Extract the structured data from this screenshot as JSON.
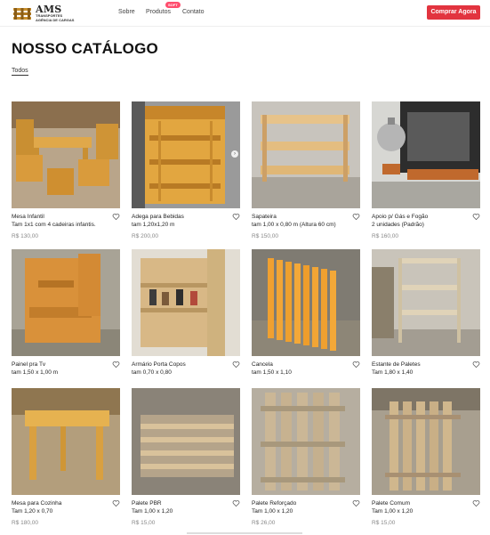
{
  "header": {
    "logo_title": "AMS",
    "logo_sub1": "TRANSPORTES",
    "logo_sub2": "AGÊNCIA DE CARGAS",
    "nav": {
      "sobre": "Sobre",
      "produtos": "Produtos",
      "contato": "Contato"
    },
    "badge": "SOFT",
    "cta": "Comprar Agora"
  },
  "page": {
    "title": "NOSSO CATÁLOGO",
    "filter": "Todos"
  },
  "products": [
    {
      "name": "Mesa Infantil",
      "desc1": "Tam 1x1 com 4 cadeiras infantis.",
      "desc2": "",
      "price": "R$ 130,00"
    },
    {
      "name": "Adega para Bebidas",
      "desc1": "tam 1,20x1,20 m",
      "desc2": "",
      "price": "R$ 200,00"
    },
    {
      "name": "Sapateira",
      "desc1": "tam 1,00 x 0,80 m (Altura 60 cm)",
      "desc2": "",
      "price": "R$ 150,00"
    },
    {
      "name": "Apoio p/ Gás e Fogão",
      "desc1": "2 unidades (Padrão)",
      "desc2": "",
      "price": "R$ 160,00"
    },
    {
      "name": "Painel pra Tv",
      "desc1": "tam 1,50 x 1,00 m",
      "desc2": "",
      "price": ""
    },
    {
      "name": "Armário Porta Copos",
      "desc1": "tam 0,70 x 0,80",
      "desc2": "",
      "price": ""
    },
    {
      "name": "Cancela",
      "desc1": "tam 1,50 x 1,10",
      "desc2": "",
      "price": ""
    },
    {
      "name": "Estante de Paletes",
      "desc1": "Tam 1,80 x 1,40",
      "desc2": "",
      "price": ""
    },
    {
      "name": "Mesa para Cozinha",
      "desc1": "Tam 1,20 x 0,70",
      "desc2": "",
      "price": "R$ 180,00"
    },
    {
      "name": "Palete PBR",
      "desc1": "Tam 1,00 x 1,20",
      "desc2": "",
      "price": "R$ 15,00"
    },
    {
      "name": "Palete Reforçado",
      "desc1": "Tam 1,00 x 1,20",
      "desc2": "",
      "price": "R$ 26,00"
    },
    {
      "name": "Palete Comum",
      "desc1": "Tam 1,00 x 1,20",
      "desc2": "",
      "price": "R$ 15,00"
    }
  ],
  "colors": {
    "accent": "#e2343f",
    "badge": "#ff4d6d",
    "wood": "#d9a441"
  },
  "icons": {
    "heart": "heart-outline-icon",
    "arrow": "chevron-right-icon"
  }
}
